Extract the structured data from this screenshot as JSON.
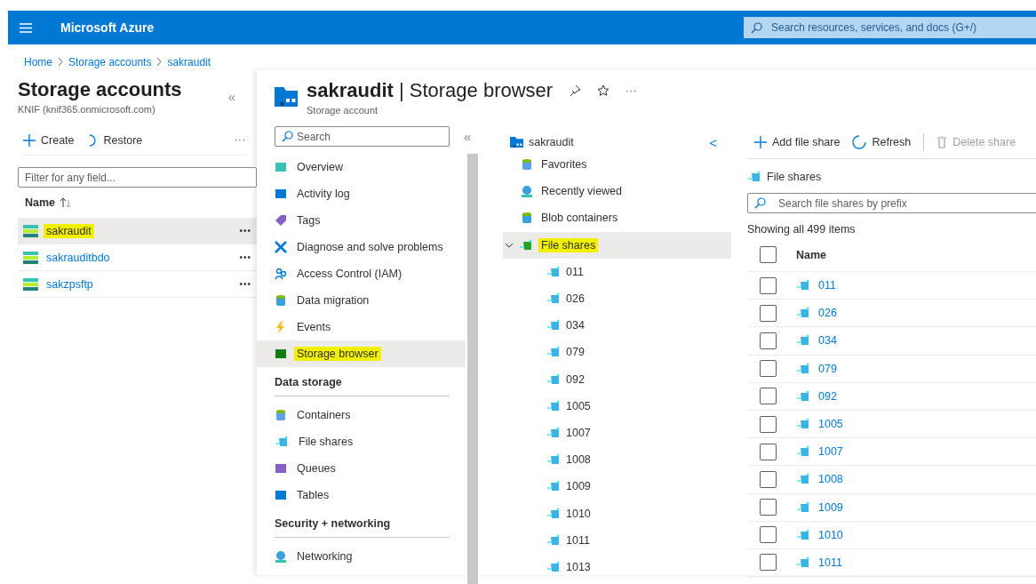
{
  "topbar": {
    "title": "Microsoft Azure",
    "search_placeholder": "Search resources, services, and docs (G+/)"
  },
  "breadcrumb": [
    "Home",
    "Storage accounts",
    "sakraudit"
  ],
  "accounts_panel": {
    "title": "Storage accounts",
    "subtitle": "KNIF (knif365.onmicrosoft.com)",
    "collapse": "«",
    "toolbar": [
      "Create",
      "Restore"
    ],
    "more": "···",
    "filter_placeholder": "Filter for any field...",
    "column": "Name",
    "rows": [
      {
        "name": "sakraudit",
        "selected": true,
        "highlighted": true,
        "more": "•••"
      },
      {
        "name": "sakrauditbdo",
        "selected": false,
        "highlighted": false,
        "more": "•••"
      },
      {
        "name": "sakzpsftp",
        "selected": false,
        "highlighted": false,
        "more": "•••"
      }
    ]
  },
  "blade": {
    "title": "**sakraudit** | Storage browser",
    "subtitle": "Storage account",
    "more": "···"
  },
  "nav": {
    "search_placeholder": "Search",
    "collapse": "«",
    "sections": [
      {
        "items": [
          {
            "label": "Overview",
            "selected": false,
            "highlighted": false
          },
          {
            "label": "Activity log",
            "selected": false,
            "highlighted": false
          },
          {
            "label": "Tags",
            "selected": false,
            "highlighted": false
          },
          {
            "label": "Diagnose and solve problems",
            "selected": false,
            "highlighted": false
          },
          {
            "label": "Access Control (IAM)",
            "selected": false,
            "highlighted": false
          },
          {
            "label": "Data migration",
            "selected": false,
            "highlighted": false
          },
          {
            "label": "Events",
            "selected": false,
            "highlighted": false
          },
          {
            "label": "Storage browser",
            "selected": true,
            "highlighted": true
          }
        ]
      },
      {
        "heading": "Data storage",
        "items": [
          {
            "label": "Containers",
            "selected": false,
            "highlighted": false
          },
          {
            "label": "File shares",
            "selected": false,
            "highlighted": false
          },
          {
            "label": "Queues",
            "selected": false,
            "highlighted": false
          },
          {
            "label": "Tables",
            "selected": false,
            "highlighted": false
          }
        ]
      },
      {
        "heading": "Security + networking",
        "items": [
          {
            "label": "Networking",
            "selected": false,
            "highlighted": false
          }
        ]
      }
    ]
  },
  "tree": {
    "root": "sakraudit",
    "collapse": "<",
    "children": [
      {
        "label": "Favorites",
        "selected": false,
        "highlighted": false
      },
      {
        "label": "Recently viewed",
        "selected": false,
        "highlighted": false
      },
      {
        "label": "Blob containers",
        "selected": false,
        "highlighted": false
      },
      {
        "label": "File shares",
        "selected": true,
        "highlighted": true,
        "expanded": true,
        "children": [
          {
            "label": "011"
          },
          {
            "label": "026"
          },
          {
            "label": "034"
          },
          {
            "label": "079"
          },
          {
            "label": "092"
          },
          {
            "label": "1005"
          },
          {
            "label": "1007"
          },
          {
            "label": "1008"
          },
          {
            "label": "1009"
          },
          {
            "label": "1010"
          },
          {
            "label": "1011"
          },
          {
            "label": "1013"
          }
        ]
      }
    ]
  },
  "content": {
    "toolbar": [
      {
        "label": "Add file share",
        "disabled": false
      },
      {
        "label": "Refresh",
        "disabled": false
      },
      {
        "label": "Delete share",
        "disabled": true
      }
    ],
    "title": "File shares",
    "search_placeholder": "Search file shares by prefix",
    "count": "Showing all 499 items",
    "column": "Name",
    "all_checked": false,
    "rows": [
      {
        "name": "011",
        "checked": false
      },
      {
        "name": "026",
        "checked": false
      },
      {
        "name": "034",
        "checked": false
      },
      {
        "name": "079",
        "checked": false
      },
      {
        "name": "092",
        "checked": false
      },
      {
        "name": "1005",
        "checked": false
      },
      {
        "name": "1007",
        "checked": false
      },
      {
        "name": "1008",
        "checked": false
      },
      {
        "name": "1009",
        "checked": false
      },
      {
        "name": "1010",
        "checked": false
      },
      {
        "name": "1011",
        "checked": false
      }
    ]
  }
}
